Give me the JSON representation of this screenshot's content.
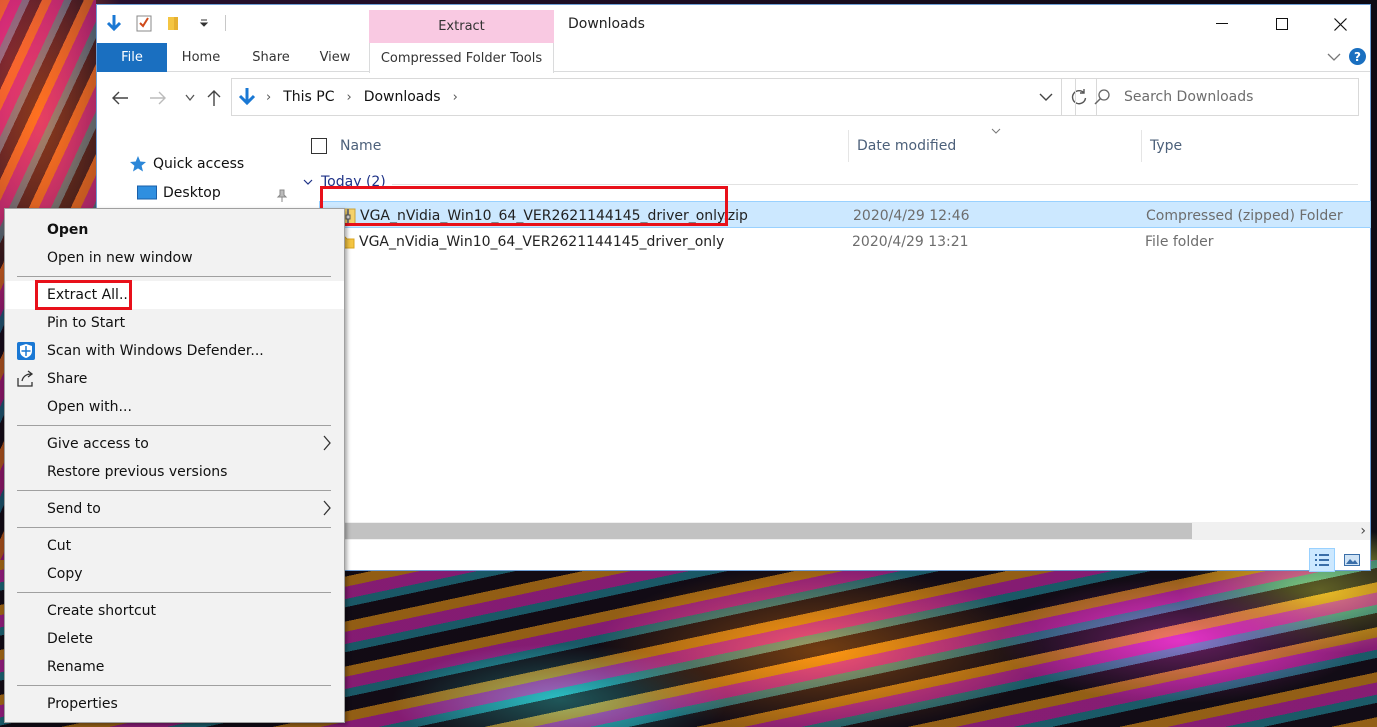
{
  "window": {
    "title": "Downloads",
    "context_tab_group": "Extract",
    "minimize_label": "Minimize",
    "maximize_label": "Maximize",
    "close_label": "Close"
  },
  "ribbon": {
    "tabs": [
      "File",
      "Home",
      "Share",
      "View",
      "Compressed Folder Tools"
    ],
    "help_label": "?"
  },
  "address": {
    "crumbs": [
      "This PC",
      "Downloads"
    ],
    "search_placeholder": "Search Downloads"
  },
  "nav_pane": {
    "items": [
      {
        "label": "Quick access",
        "icon": "star-icon"
      },
      {
        "label": "Desktop",
        "icon": "desktop-icon",
        "pinned": true
      }
    ]
  },
  "columns": [
    "Name",
    "Date modified",
    "Type"
  ],
  "group": {
    "label": "Today (2)"
  },
  "files": [
    {
      "name": "VGA_nVidia_Win10_64_VER2621144145_driver_only.zip",
      "date": "2020/4/29 12:46",
      "type": "Compressed (zipped) Folder",
      "icon": "zip-folder-icon",
      "selected": true
    },
    {
      "name": "VGA_nVidia_Win10_64_VER2621144145_driver_only",
      "date": "2020/4/29 13:21",
      "type": "File folder",
      "icon": "folder-icon",
      "selected": false
    }
  ],
  "context_menu": {
    "groups": [
      [
        "Open",
        "Open in new window"
      ],
      [
        "Extract All...",
        "Pin to Start",
        "Scan with Windows Defender...",
        "Share",
        "Open with..."
      ],
      [
        "Give access to",
        "Restore previous versions"
      ],
      [
        "Send to"
      ],
      [
        "Cut",
        "Copy"
      ],
      [
        "Create shortcut",
        "Delete",
        "Rename"
      ],
      [
        "Properties"
      ]
    ]
  },
  "colors": {
    "accent": "#1a6fc0",
    "selection": "#cce8ff",
    "context_tab": "#f9c9e2",
    "highlight_box": "#e8101a"
  }
}
